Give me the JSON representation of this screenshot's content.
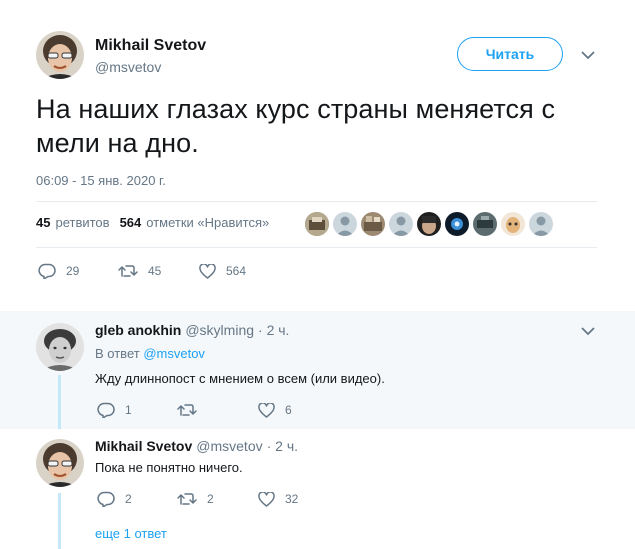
{
  "main_tweet": {
    "author_name": "Mikhail Svetov",
    "author_handle": "@msvetov",
    "follow_label": "Читать",
    "text": "На наших глазах курс страны меняется с мели на дно.",
    "timestamp": "06:09 - 15 янв. 2020 г.",
    "retweets_count": "45",
    "retweets_label": "ретвитов",
    "likes_count": "564",
    "likes_label": "отметки «Нравится»",
    "actions": {
      "replies": "29",
      "retweets": "45",
      "likes": "564"
    }
  },
  "replies": [
    {
      "author_name": "gleb anokhin",
      "author_handle": "@skylming",
      "time": "· 2 ч.",
      "reply_prefix": "В ответ",
      "reply_to": "@msvetov",
      "text": "Жду длиннопост с мнением о всем (или видео).",
      "actions": {
        "replies": "1",
        "retweets": "",
        "likes": "6"
      }
    },
    {
      "author_name": "Mikhail Svetov",
      "author_handle": "@msvetov",
      "time": "· 2 ч.",
      "text": "Пока не понятно ничего.",
      "actions": {
        "replies": "2",
        "retweets": "2",
        "likes": "32"
      }
    }
  ],
  "more_replies_link": "еще 1 ответ",
  "colors": {
    "accent": "#1da1f2",
    "muted": "#657786",
    "thread_line": "#c4e8f7",
    "thread_bg": "#f5f8fa"
  }
}
